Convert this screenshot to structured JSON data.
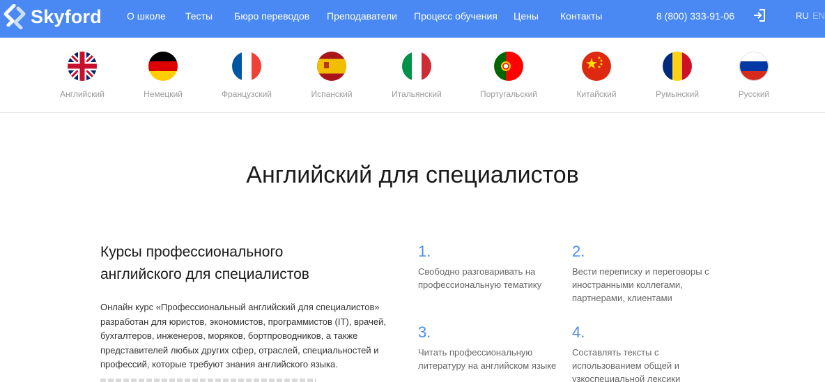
{
  "header": {
    "logo_text": "Skyford",
    "nav": [
      "О школе",
      "Тесты",
      "Бюро переводов",
      "Преподаватели",
      "Процесс обучения",
      "Цены",
      "Контакты"
    ],
    "phone": "8 (800) 333-91-06",
    "lang_current": "RU",
    "lang_other": "EN",
    "colors": {
      "bar": "#4a89f3",
      "text": "#ffffff"
    }
  },
  "languages": [
    {
      "label": "Английский",
      "flag": "uk-flag-icon"
    },
    {
      "label": "Немецкий",
      "flag": "germany-flag-icon"
    },
    {
      "label": "Французский",
      "flag": "france-flag-icon"
    },
    {
      "label": "Испанский",
      "flag": "spain-flag-icon"
    },
    {
      "label": "Итальянский",
      "flag": "italy-flag-icon"
    },
    {
      "label": "Португальский",
      "flag": "portugal-flag-icon"
    },
    {
      "label": "Китайский",
      "flag": "china-flag-icon"
    },
    {
      "label": "Румынский",
      "flag": "romania-flag-icon"
    },
    {
      "label": "Русский",
      "flag": "russia-flag-icon"
    }
  ],
  "main": {
    "title": "Английский для специалистов",
    "section_heading_line1": "Курсы профессионального",
    "section_heading_line2": "английского для специалистов",
    "description": [
      "Онлайн курс «Профессиональный английский для специалистов»",
      "разработан для юристов, экономистов, программистов (IT), врачей,",
      "бухгалтеров, инженеров, моряков, бортпроводников, а также",
      "представителей любых других сфер, отраслей, специальностей и",
      "профессий, которые требуют знания английского языка."
    ],
    "features": [
      {
        "num": "1.",
        "lines": [
          "Свободно разговаривать на",
          "профессиональную тематику"
        ]
      },
      {
        "num": "2.",
        "lines": [
          "Вести переписку и переговоры с",
          "иностранными коллегами,",
          "партнерами, клиентами"
        ]
      },
      {
        "num": "3.",
        "lines": [
          "Читать профессиональную",
          "литературу на английском языке"
        ]
      },
      {
        "num": "4.",
        "lines": [
          "Составлять тексты с",
          "использованием общей и",
          "узкоспециальной лексики"
        ]
      }
    ],
    "accent_color": "#4a89f3"
  }
}
